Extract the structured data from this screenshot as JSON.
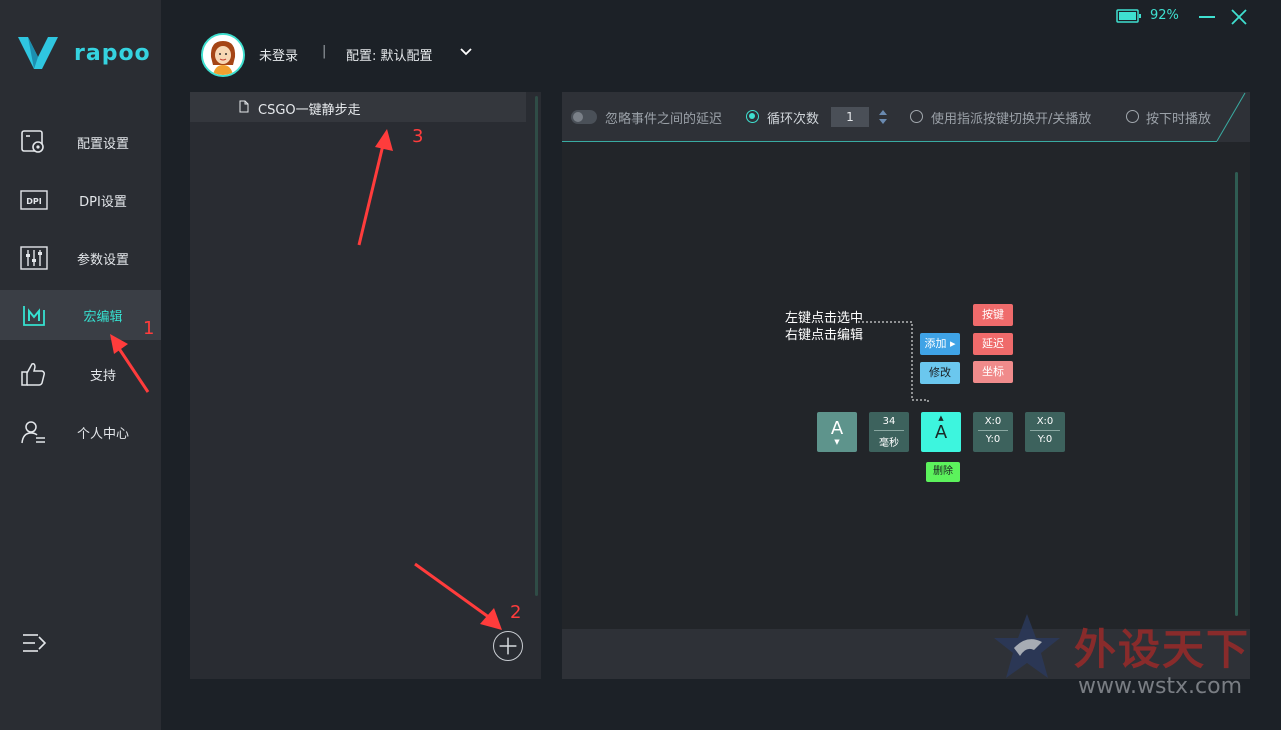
{
  "app": {
    "brand": "rapoo"
  },
  "topbar": {
    "battery_pct": "92%",
    "login_status": "未登录",
    "separator": "|",
    "config_label": "配置: 默认配置"
  },
  "sidebar": {
    "items": [
      {
        "label": "配置设置",
        "icon": "config-icon"
      },
      {
        "label": "DPI设置",
        "icon": "dpi-icon"
      },
      {
        "label": "参数设置",
        "icon": "sliders-icon"
      },
      {
        "label": "宏编辑",
        "icon": "macro-icon",
        "active": true
      },
      {
        "label": "支持",
        "icon": "thumbs-up-icon"
      },
      {
        "label": "个人中心",
        "icon": "user-icon"
      }
    ]
  },
  "macro_list": {
    "items": [
      {
        "name": "CSGO一键静步走"
      }
    ]
  },
  "toolbar": {
    "ignore_delay": "忽略事件之间的延迟",
    "loop_count_label": "循环次数",
    "loop_count_value": "1",
    "toggle_by_key": "使用指派按键切换开/关播放",
    "play_while_pressed": "按下时播放"
  },
  "help": {
    "line1": "左键点击选中",
    "line2": "右键点击编辑",
    "add": "添加",
    "modify": "修改",
    "key": "按键",
    "delay": "延迟",
    "coord": "坐标",
    "delete": "删除",
    "card_key1": "A",
    "card_delay_value": "34",
    "card_delay_unit": "毫秒",
    "card_key2": "A",
    "card_x1": "X:0",
    "card_y1": "Y:0",
    "card_x2": "X:0",
    "card_y2": "Y:0"
  },
  "annotations": {
    "n1": "1",
    "n2": "2",
    "n3": "3"
  },
  "watermark": {
    "title": "外设天下",
    "url": "www.wstx.com"
  },
  "colors": {
    "accent": "#3fe0d0",
    "annotation": "#ff3c3c"
  }
}
